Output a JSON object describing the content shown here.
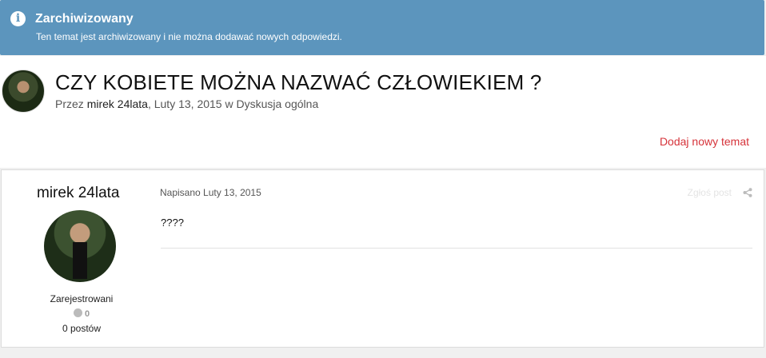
{
  "notice": {
    "icon": "info-icon",
    "title": "Zarchiwizowany",
    "text": "Ten temat jest archiwizowany i nie można dodawać nowych odpowiedzi."
  },
  "topic": {
    "title": "CZY KOBIETE MOŻNA NAZWAĆ CZŁOWIEKIEM ?",
    "byline_prefix": "Przez",
    "author": "mirek 24lata",
    "date": "Luty 13, 2015",
    "in": "w",
    "forum": "Dyskusja ogólna",
    "new_topic_label": "Dodaj nowy temat"
  },
  "post": {
    "author": "mirek 24lata",
    "group": "Zarejestrowani",
    "reputation": "0",
    "post_count": "0 postów",
    "date_label": "Napisano Luty 13, 2015",
    "report_label": "Zgłoś post",
    "body": "????"
  },
  "colors": {
    "notice_bg": "#5c95bd",
    "accent_link": "#d6333a"
  }
}
